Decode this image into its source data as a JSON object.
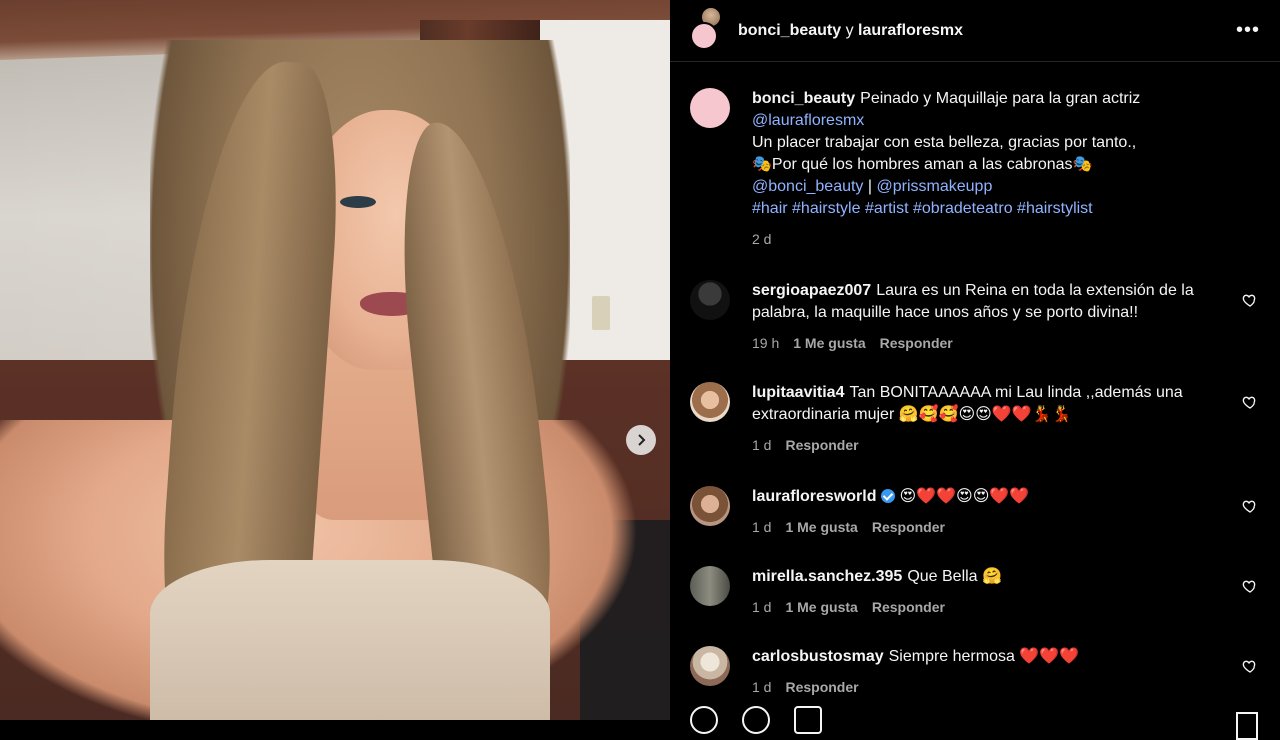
{
  "header": {
    "user1": "bonci_beauty",
    "sep": "y",
    "user2": "laurafloresmx",
    "more": "•••"
  },
  "caption": {
    "user": "bonci_beauty",
    "line1": "Peinado y Maquillaje para la gran actriz",
    "mention": "@laurafloresmx",
    "line2": "Un placer trabajar con esta belleza, gracias por tanto.,",
    "line3": "🎭Por qué los hombres aman a las cabronas🎭",
    "mention2": "@bonci_beauty",
    "pipe": "|",
    "mention3": "@prissmakeupp",
    "hashtags": "#hair #hairstyle #artist #obradeteatro #hairstylist",
    "time": "2 d"
  },
  "comments": [
    {
      "user": "sergioapaez007",
      "text": "Laura es un Reina en toda la extensión de la palabra, la maquille hace unos años y se porto divina!!",
      "time": "19 h",
      "likes": "1 Me gusta",
      "reply": "Responder"
    },
    {
      "user": "lupitaavitia4",
      "text": "Tan BONITAAAAAA mi Lau linda ,,además una extraordinaria mujer 🤗🥰🥰😍😍❤️❤️💃💃",
      "time": "1 d",
      "reply": "Responder"
    },
    {
      "user": "laurafloresworld",
      "text": "😍❤️❤️😍😍❤️❤️",
      "time": "1 d",
      "likes": "1 Me gusta",
      "reply": "Responder"
    },
    {
      "user": "mirella.sanchez.395",
      "text": "Que Bella 🤗",
      "time": "1 d",
      "likes": "1 Me gusta",
      "reply": "Responder"
    },
    {
      "user": "carlosbustosmay",
      "text": "Siempre hermosa ❤️❤️❤️",
      "time": "1 d",
      "reply": "Responder"
    }
  ],
  "icons": {
    "next": "chevron-right-icon",
    "like": "heart-icon",
    "verified": "verified-badge-icon"
  }
}
